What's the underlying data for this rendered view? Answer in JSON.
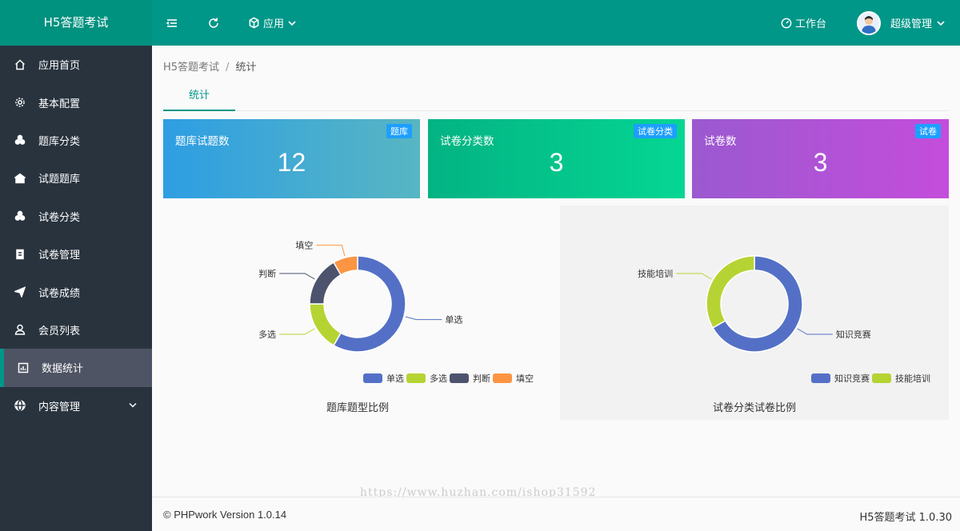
{
  "app": {
    "title": "H5答题考试"
  },
  "header": {
    "menu_label": "应用",
    "workbench_label": "工作台",
    "user_label": "超级管理"
  },
  "sidebar": {
    "items": [
      {
        "label": "应用首页",
        "icon": "home-icon"
      },
      {
        "label": "基本配置",
        "icon": "gear-icon"
      },
      {
        "label": "题库分类",
        "icon": "cubes-icon"
      },
      {
        "label": "试题题库",
        "icon": "bank-icon"
      },
      {
        "label": "试卷分类",
        "icon": "cubes-icon"
      },
      {
        "label": "试卷管理",
        "icon": "doc-icon"
      },
      {
        "label": "试卷成绩",
        "icon": "send-icon"
      },
      {
        "label": "会员列表",
        "icon": "user-icon"
      },
      {
        "label": "数据统计",
        "icon": "chart-icon",
        "active": true
      },
      {
        "label": "内容管理",
        "icon": "globe-icon",
        "has_children": true
      }
    ]
  },
  "breadcrumb": {
    "root": "H5答题考试",
    "separator": "/",
    "current": "统计"
  },
  "tabs": [
    {
      "label": "统计"
    }
  ],
  "stats": [
    {
      "label": "题库试题数",
      "badge": "题库",
      "value": "12"
    },
    {
      "label": "试卷分类数",
      "badge": "试卷分类",
      "value": "3"
    },
    {
      "label": "试卷数",
      "badge": "试卷",
      "value": "3"
    }
  ],
  "chart_data": [
    {
      "type": "pie",
      "title": "题库题型比例",
      "categories": [
        "单选",
        "多选",
        "判断",
        "填空"
      ],
      "values": [
        7,
        2,
        2,
        1
      ],
      "colors": [
        "#5470c6",
        "#b6d334",
        "#4d536c",
        "#fb9543"
      ],
      "legend": "bottom-right"
    },
    {
      "type": "pie",
      "title": "试卷分类试卷比例",
      "categories": [
        "知识竞赛",
        "技能培训"
      ],
      "values": [
        2,
        1
      ],
      "colors": [
        "#5470c6",
        "#b6d334"
      ],
      "legend": "bottom-right"
    }
  ],
  "footer": {
    "left": "© PHPwork Version 1.0.14",
    "right": "H5答题考试 1.0.30"
  },
  "watermark": "https://www.huzhan.com/ishop31592"
}
